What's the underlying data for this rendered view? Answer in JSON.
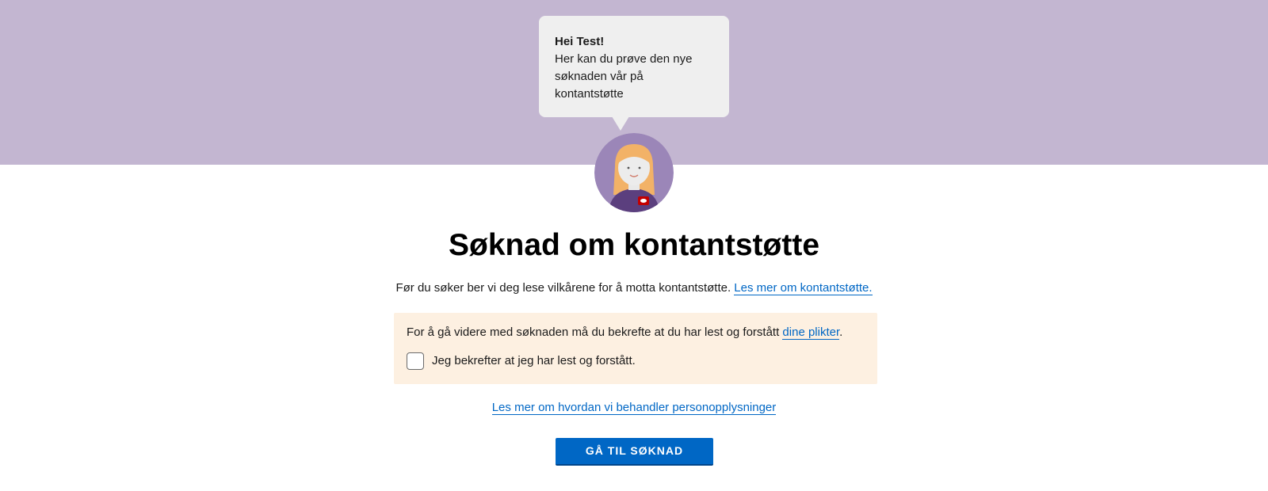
{
  "banner": {
    "bubble": {
      "greeting": "Hei Test!",
      "message": "Her kan du prøve den nye søknaden vår på kontantstøtte"
    },
    "background_color": "#c3b6d1"
  },
  "page_title": "Søknad om kontantstøtte",
  "intro": {
    "text": "Før du søker ber vi deg lese vilkårene for å motta kontantstøtte. ",
    "link_text": "Les mer om kontantstøtte."
  },
  "notice": {
    "text": "For å gå videre med søknaden må du bekrefte at du har lest og forstått ",
    "link_text": "dine plikter",
    "text_after": ".",
    "checkbox_label": "Jeg bekrefter at jeg har lest og forstått.",
    "checkbox_checked": false,
    "background_color": "#fdf0e1"
  },
  "privacy_link": "Les mer om hvordan vi behandler personopplysninger",
  "cta_button": "GÅ TIL SØKNAD",
  "colors": {
    "link": "#0067c5",
    "button": "#0067c5"
  },
  "icons": {
    "avatar": "veileder-avatar-icon"
  }
}
